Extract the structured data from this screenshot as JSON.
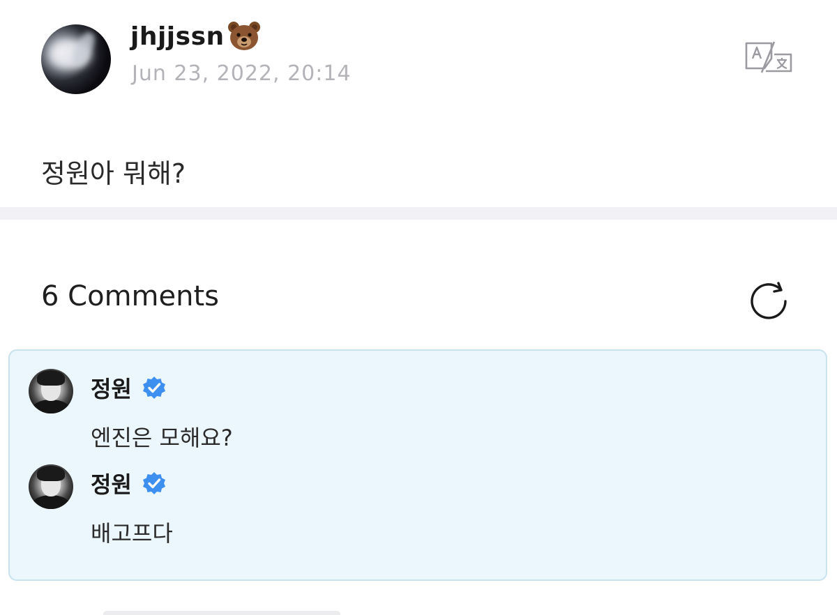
{
  "post": {
    "username": "jhjjssn",
    "username_emoji_icon": "bear-face-icon",
    "date": "Jun 23, 2022, 20:14",
    "body": "정원아 뭐해?",
    "translate_icon": "translate-icon"
  },
  "comments_section": {
    "title": "6 Comments",
    "refresh_icon": "refresh-icon",
    "items": [
      {
        "name": "정원",
        "verified": true,
        "text": "엔진은 모해요?"
      },
      {
        "name": "정원",
        "verified": true,
        "text": "배고프다"
      }
    ]
  },
  "colors": {
    "verified_blue": "#3d8ff0",
    "date_gray": "#b3b3b8",
    "comment_bg": "#ecf6fd",
    "comment_border": "#c8e2ee",
    "divider": "#f2f2f6"
  }
}
